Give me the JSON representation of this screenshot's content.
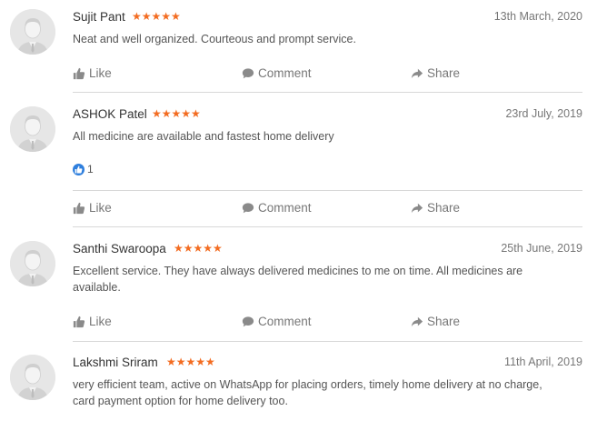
{
  "actions": {
    "like": "Like",
    "comment": "Comment",
    "share": "Share"
  },
  "reviews": [
    {
      "name": "Sujit Pant",
      "stars": "★★★★★",
      "rating": 4.5,
      "date": "13th March, 2020",
      "text": "Neat and well organized. Courteous and prompt service."
    },
    {
      "name": "ASHOK Patel",
      "stars": "★★★★★",
      "rating": 5,
      "date": "23rd July, 2019",
      "text": "All medicine are available and fastest home delivery",
      "likes": "1"
    },
    {
      "name": "Santhi Swaroopa",
      "stars": "★★★★★",
      "rating": 4.5,
      "date": "25th June, 2019",
      "text_line1": "Excellent service. They have always delivered medicines to me on time. All medicines are",
      "text_line2": "available."
    },
    {
      "name": "Lakshmi Sriram",
      "stars": "★★★★★",
      "rating": 5,
      "date": "11th April, 2019",
      "text_line1": "very efficient team, active on WhatsApp for placing orders, timely home delivery at no charge,",
      "text_line2": "card payment option for home delivery too."
    }
  ],
  "colors": {
    "star": "#f36c21",
    "like_badge": "#2f7fdd",
    "divider": "#d8d8d8"
  }
}
